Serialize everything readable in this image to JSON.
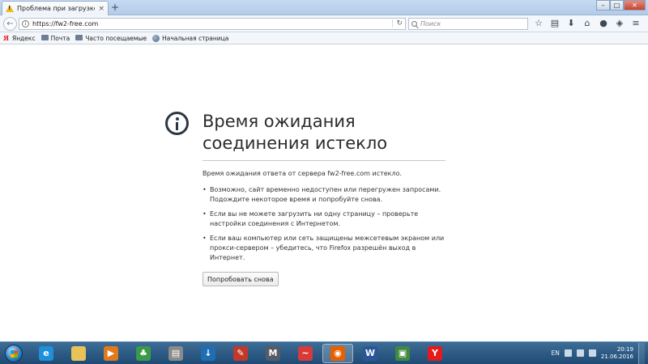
{
  "window": {
    "tab_title": "Проблема при загрузке с...",
    "tab_close": "×",
    "new_tab": "+",
    "controls": {
      "minimize": "–",
      "maximize": "□",
      "close": "✕"
    }
  },
  "navbar": {
    "url": "https://fw2-free.com",
    "search_placeholder": "Поиск",
    "icons": [
      "star-icon",
      "clipboard-icon",
      "download-icon",
      "home-icon",
      "chat-icon",
      "pocket-icon",
      "menu-icon"
    ]
  },
  "bookmarks": [
    {
      "label": "Яндекс",
      "icon": "yandex-icon"
    },
    {
      "label": "Почта",
      "icon": "folder-icon"
    },
    {
      "label": "Часто посещаемые",
      "icon": "folder-icon"
    },
    {
      "label": "Начальная страница",
      "icon": "globe-icon"
    }
  ],
  "error": {
    "title": "Время ожидания соединения истекло",
    "intro": "Время ожидания ответа от сервера fw2-free.com истекло.",
    "items": [
      "Возможно, сайт временно недоступен или перегружен запросами. Подождите некоторое время и попробуйте снова.",
      "Если вы не можете загрузить ни одну страницу – проверьте настройки соединения с Интернетом.",
      "Если ваш компьютер или сеть защищены межсетевым экраном или прокси-сервером – убедитесь, что Firefox разрешён выход в Интернет."
    ],
    "retry_button": "Попробовать снова"
  },
  "taskbar": {
    "apps": [
      {
        "name": "internet-explorer-app",
        "glyph": "e",
        "color": "#1e8fd8"
      },
      {
        "name": "file-explorer-app",
        "glyph": "",
        "color": "#e8c35a"
      },
      {
        "name": "media-player-app",
        "glyph": "▶",
        "color": "#e07a1f"
      },
      {
        "name": "games-app",
        "glyph": "♣",
        "color": "#3a9a4a"
      },
      {
        "name": "printer-app",
        "glyph": "▤",
        "color": "#8a8a8a"
      },
      {
        "name": "download-manager-app",
        "glyph": "↓",
        "color": "#1f6db3"
      },
      {
        "name": "pdf-app",
        "glyph": "✎",
        "color": "#c0392b"
      },
      {
        "name": "m-app",
        "glyph": "M",
        "color": "#555c66"
      },
      {
        "name": "lips-app",
        "glyph": "~",
        "color": "#d63a3a"
      },
      {
        "name": "firefox-app",
        "glyph": "◉",
        "color": "#e66000"
      },
      {
        "name": "word-app",
        "glyph": "W",
        "color": "#2b579a"
      },
      {
        "name": "screenshot-app",
        "glyph": "▣",
        "color": "#3f8a3f"
      },
      {
        "name": "yandex-browser-app",
        "glyph": "Y",
        "color": "#e31b1b"
      }
    ],
    "active_app": "firefox-app",
    "language": "EN",
    "time": "20:19",
    "date": "21.06.2016"
  }
}
